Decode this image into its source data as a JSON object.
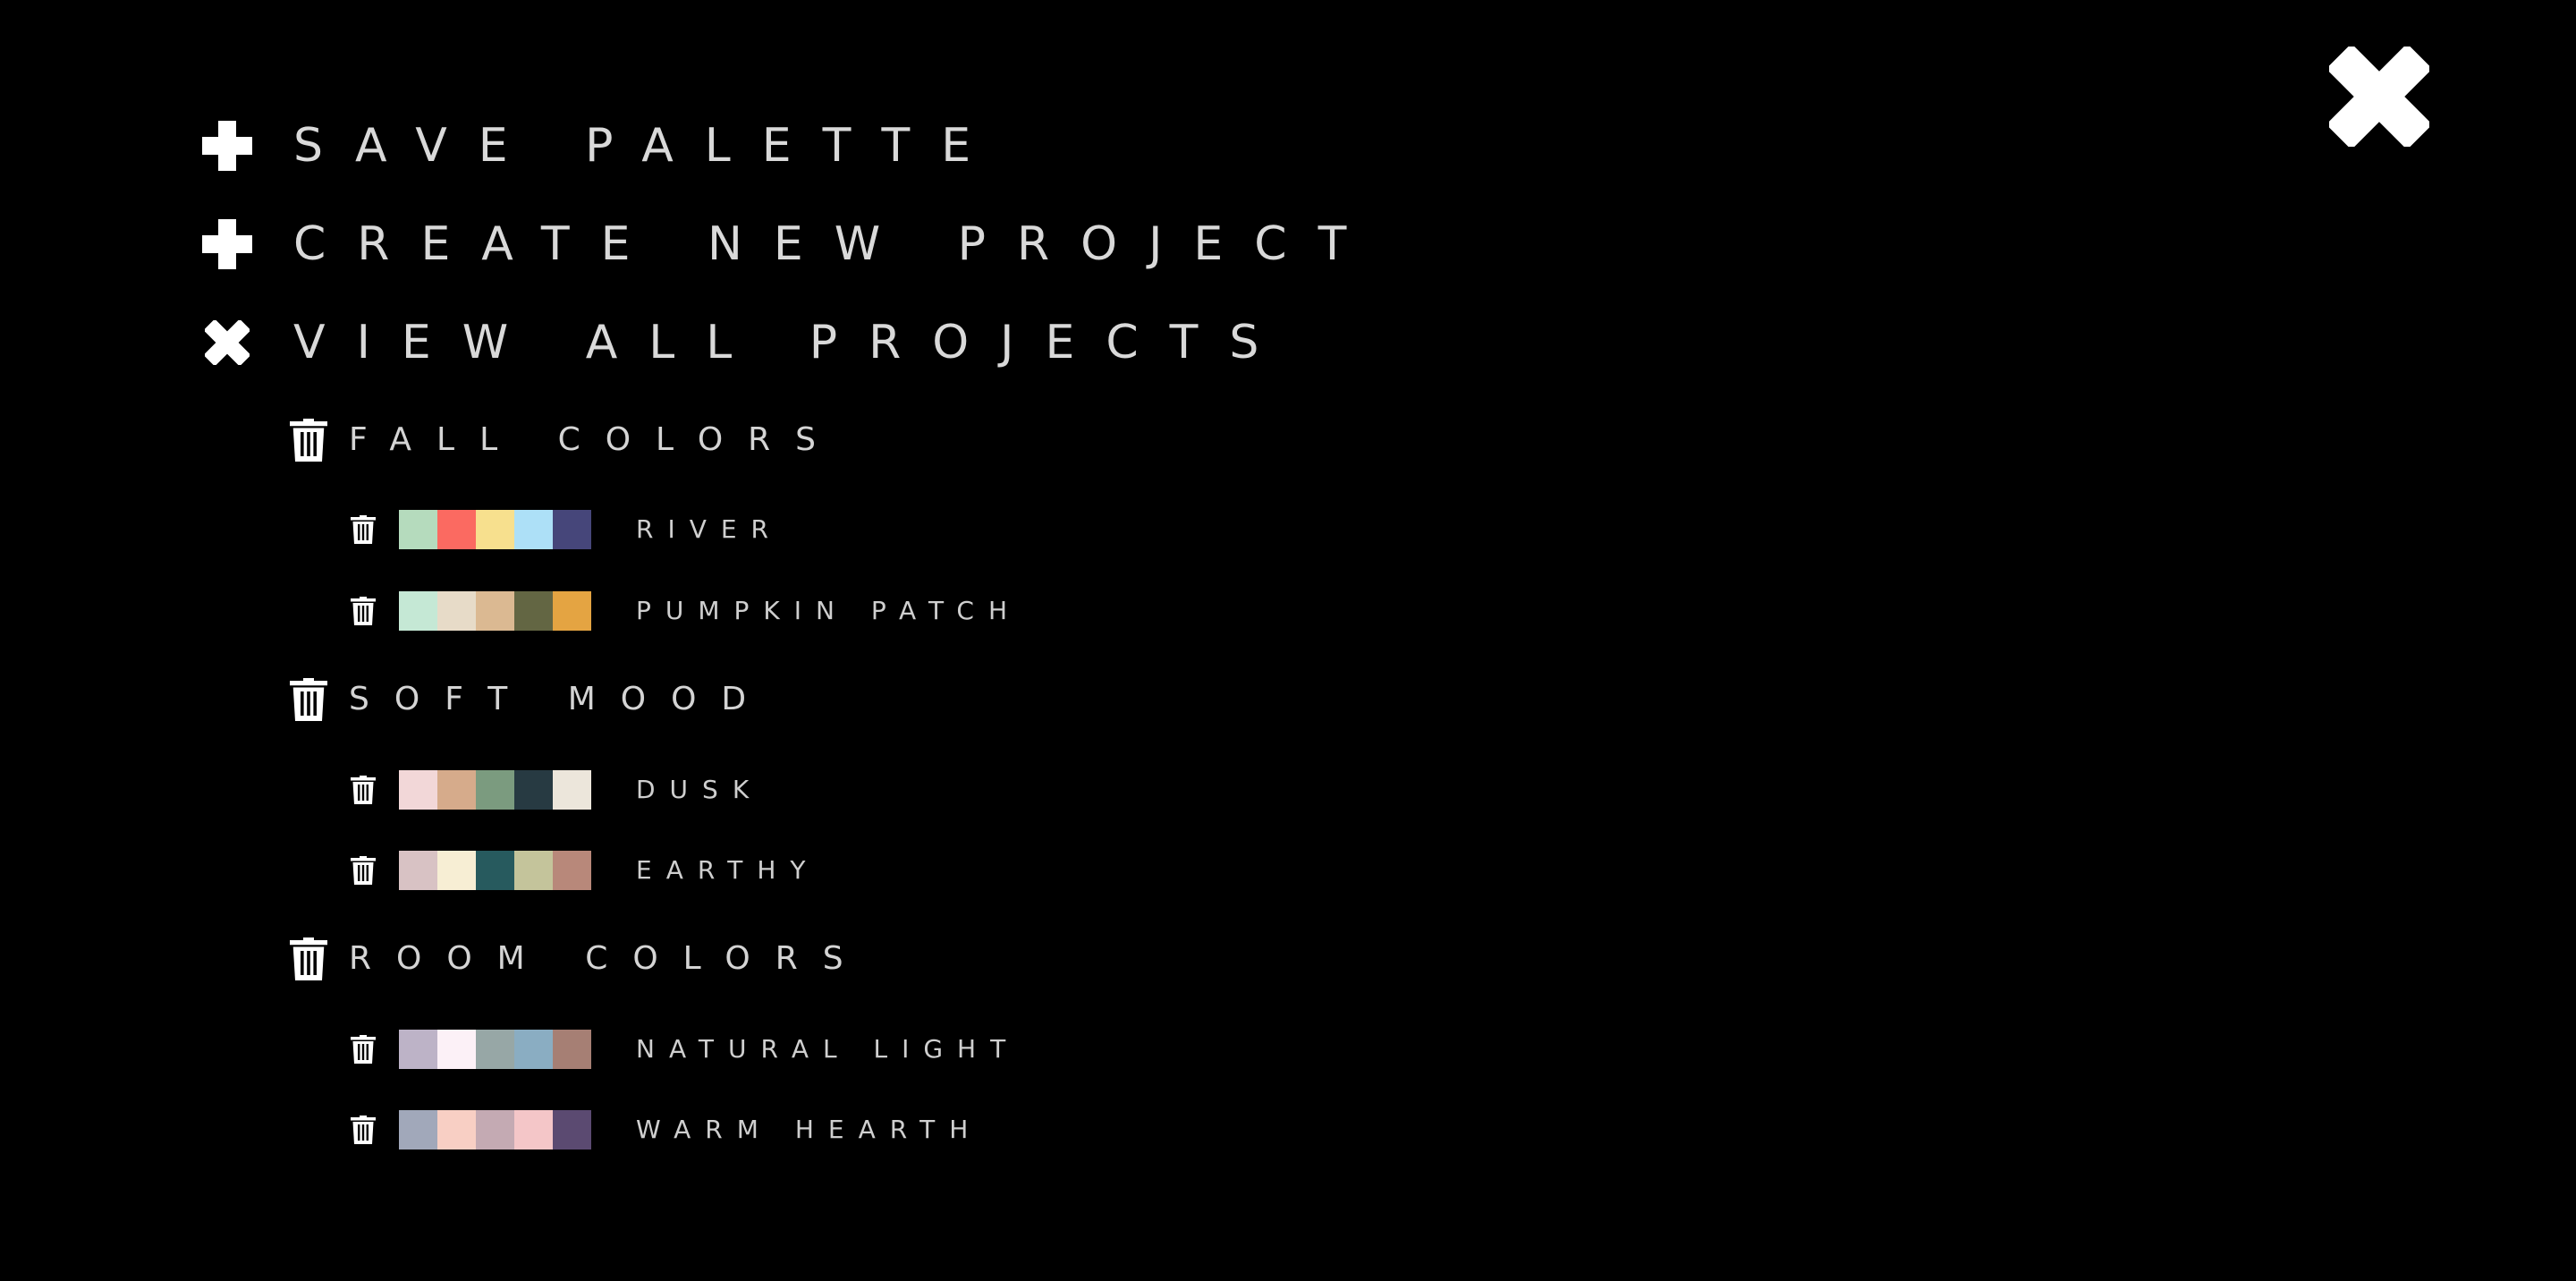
{
  "menu": {
    "save_palette": "SAVE PALETTE",
    "create_new_project": "CREATE NEW PROJECT",
    "view_all_projects": "VIEW ALL PROJECTS"
  },
  "icons": {
    "close": "close-icon",
    "plus": "plus-icon",
    "collapse": "close-icon",
    "delete": "trash-icon"
  },
  "projects": [
    {
      "name": "FALL COLORS",
      "palettes": [
        {
          "name": "RIVER",
          "colors": [
            "#b5dbbd",
            "#fb6a61",
            "#f7e08e",
            "#ade0f7",
            "#46467a"
          ]
        },
        {
          "name": "PUMPKIN PATCH",
          "colors": [
            "#c5e8d5",
            "#e7dbc8",
            "#dbb992",
            "#636643",
            "#e4a442"
          ]
        }
      ]
    },
    {
      "name": "SOFT MOOD",
      "palettes": [
        {
          "name": "DUSK",
          "colors": [
            "#f2d7d8",
            "#d6ab8b",
            "#7b9b7f",
            "#273a42",
            "#ece6db"
          ]
        },
        {
          "name": "EARTHY",
          "colors": [
            "#d8c2c4",
            "#f7eed4",
            "#275a5e",
            "#c4c49b",
            "#b8887a"
          ]
        }
      ]
    },
    {
      "name": "ROOM COLORS",
      "palettes": [
        {
          "name": "NATURAL LIGHT",
          "colors": [
            "#bdb3c7",
            "#fcf1f7",
            "#97a7a6",
            "#8aadc2",
            "#a67f74"
          ]
        },
        {
          "name": "WARM HEARTH",
          "colors": [
            "#a1a8ba",
            "#f8cfc4",
            "#c4aab3",
            "#f4c6c8",
            "#5b4a71"
          ]
        }
      ]
    }
  ]
}
